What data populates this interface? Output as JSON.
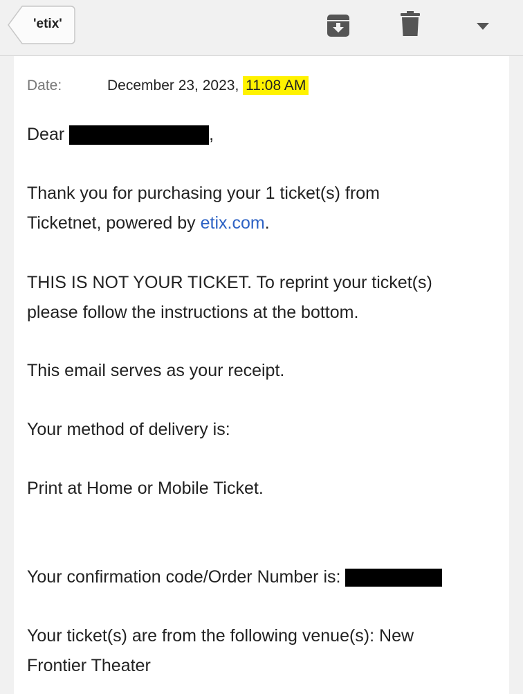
{
  "toolbar": {
    "back_label": "'etix'",
    "icons": [
      "archive-icon",
      "trash-icon",
      "dropdown-icon"
    ]
  },
  "header": {
    "date_label": "Date:",
    "date_value": "December 23, 2023,",
    "time_value": "11:08 AM"
  },
  "body": {
    "greeting": "Dear",
    "greeting_end": ",",
    "thanks_prefix": "Thank you for purchasing your 1 ticket(s) from Ticketnet, powered by ",
    "thanks_link": "etix.com",
    "thanks_suffix": ".",
    "not_ticket": "THIS IS NOT YOUR TICKET. To reprint your ticket(s) please follow the instructions at the bottom.",
    "receipt": "This email serves as your receipt.",
    "delivery_intro": "Your method of delivery is:",
    "delivery_method": "Print at Home or Mobile Ticket.",
    "confirmation": "Your confirmation code/Order Number is:",
    "venue": "Your ticket(s) are from the following venue(s): New Frontier Theater"
  },
  "colors": {
    "highlight": "#fff200",
    "link": "#2d62c4",
    "redaction": "#000000"
  }
}
